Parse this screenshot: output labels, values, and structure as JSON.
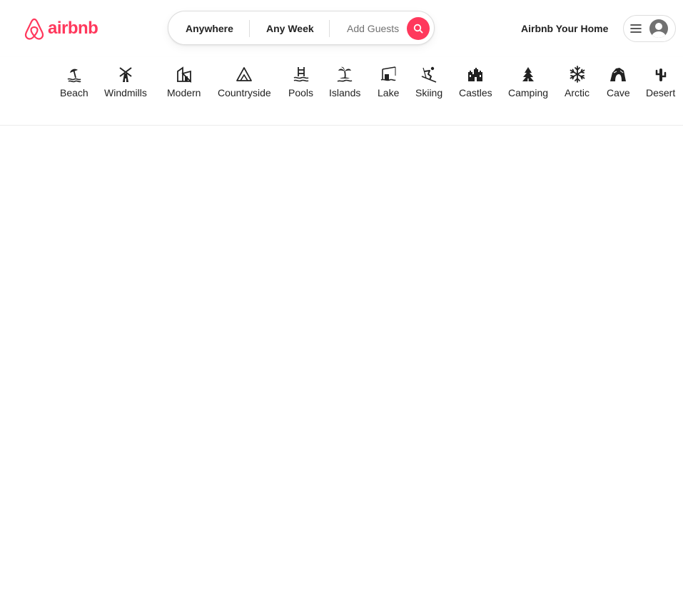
{
  "brand": {
    "name": "airbnb",
    "color": "#ff385c"
  },
  "search": {
    "location_label": "Anywhere",
    "dates_label": "Any Week",
    "guests_label": "Add Guests",
    "button_icon": "search-icon"
  },
  "header": {
    "host_link": "Airbnb Your Home",
    "menu_icon": "hamburger-menu-icon",
    "avatar_icon": "user-avatar-icon"
  },
  "categories": [
    {
      "label": "Beach",
      "icon": "beach-icon"
    },
    {
      "label": "Windmills",
      "icon": "windmill-icon"
    },
    {
      "label": "Modern",
      "icon": "modern-house-icon"
    },
    {
      "label": "Countryside",
      "icon": "mountain-icon"
    },
    {
      "label": "Pools",
      "icon": "pool-icon"
    },
    {
      "label": "Islands",
      "icon": "palm-island-icon"
    },
    {
      "label": "Lake",
      "icon": "lake-fishing-icon"
    },
    {
      "label": "Skiing",
      "icon": "skier-icon"
    },
    {
      "label": "Castles",
      "icon": "castle-icon"
    },
    {
      "label": "Camping",
      "icon": "tree-icon"
    },
    {
      "label": "Arctic",
      "icon": "snowflake-icon"
    },
    {
      "label": "Cave",
      "icon": "cave-icon"
    },
    {
      "label": "Desert",
      "icon": "desert-icon"
    }
  ]
}
